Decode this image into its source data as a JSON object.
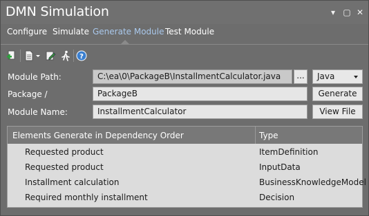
{
  "window": {
    "title": "DMN Simulation",
    "menu_glyph": "▾",
    "restore_glyph": "▢",
    "close_glyph": "✕"
  },
  "tabs": [
    {
      "label": "Configure",
      "active": false
    },
    {
      "label": "Simulate",
      "active": false
    },
    {
      "label": "Generate Module",
      "active": true
    },
    {
      "label": "Test Module",
      "active": false
    }
  ],
  "toolbar": {
    "icons": [
      "add-icon",
      "document-icon",
      "dropdown-arrow-icon",
      "edit-icon",
      "run-icon",
      "help-icon"
    ]
  },
  "form": {
    "module_path_label": "Module Path:",
    "module_path_value": "C:\\ea\\0\\PackageB\\InstallmentCalculator.java",
    "browse_label": "...",
    "language_value": "Java",
    "package_label": "Package /",
    "package_value": "PackageB",
    "generate_label": "Generate",
    "module_name_label": "Module Name:",
    "module_name_value": "InstallmentCalculator",
    "view_file_label": "View File"
  },
  "grid": {
    "columns": [
      "Elements Generate in Dependency Order",
      "Type"
    ],
    "rows": [
      [
        "Requested product",
        "ItemDefinition"
      ],
      [
        "Requested product",
        "InputData"
      ],
      [
        "Installment calculation",
        "BusinessKnowledgeModel"
      ],
      [
        "Required monthly installment",
        "Decision"
      ]
    ]
  },
  "colors": {
    "background": "#6d6d6d",
    "active_tab": "#a9c8ec",
    "field": "#e6e6e6",
    "grid": "#dcdcdc"
  }
}
